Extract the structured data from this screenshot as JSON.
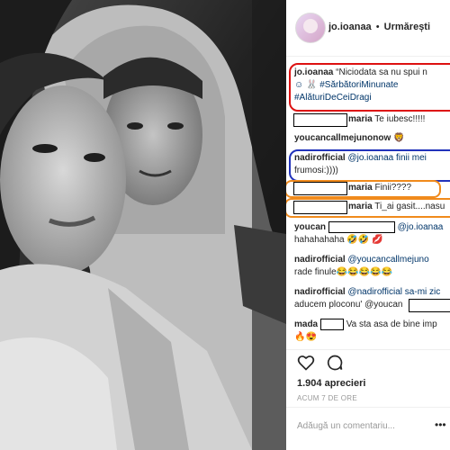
{
  "post": {
    "photo_alt": "Black and white selfie of a couple, man in white hoodie",
    "username": "jo.ioanaa",
    "dot": "•",
    "follow": "Urmărești",
    "caption_user": "jo.ioanaa",
    "caption_line1": "“Niciodata sa nu spui n",
    "caption_line2": "☺ 🐰 #SărbătoriMinunate",
    "caption_line3": "#AlăturiDeCeiDragi",
    "comments": [
      {
        "user": "maria",
        "text": "Te iubesc!!!!!"
      },
      {
        "user": "youcancallmejunonow",
        "text": "🦁"
      },
      {
        "user": "nadirofficial",
        "text": "@jo.ioanaa finii mei",
        "text2": "frumosi:))))"
      },
      {
        "user": "maria",
        "text": "Finii????"
      },
      {
        "user": "maria",
        "text": "Ti_ai gasit....nasu"
      },
      {
        "user": "youcan",
        "text": "@jo.ioanaa",
        "text2": "hahahahaha 🤣🤣 💋"
      },
      {
        "user": "nadirofficial",
        "text": "@youcancallmejuno",
        "text2": "rade finule😂😂😂😂😂"
      },
      {
        "user": "nadirofficial",
        "text": "@nadirofficial sa-mi zic",
        "text2": "aducem ploconu' @youcan"
      },
      {
        "user": "mada",
        "text": "Va sta asa de bine imp",
        "text2": "🔥😍"
      }
    ],
    "likes": "1.904 aprecieri",
    "time": "ACUM 7 DE ORE",
    "add_comment_placeholder": "Adăugă un comentariu...",
    "more": "•••"
  }
}
